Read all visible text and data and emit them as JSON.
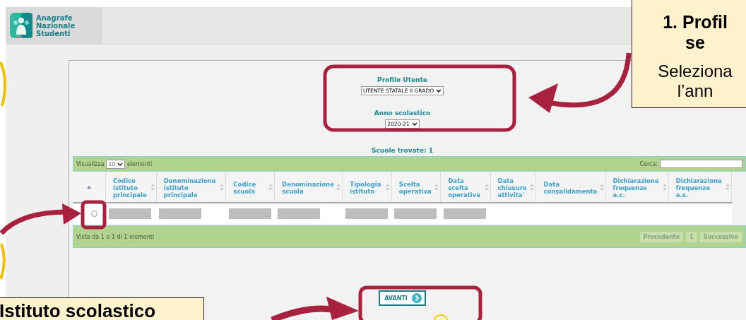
{
  "header": {
    "logo_text": "Anagrafe Nazionale Studenti"
  },
  "form": {
    "profile_label": "Profilo Utente",
    "profile_value": "UTENTE STATALE II GRADO",
    "year_label": "Anno scolastico",
    "year_value": "2020-21",
    "found": "Scuole trovate: 1"
  },
  "table_toolbar": {
    "show_prefix": "Visualizza",
    "page_size": "10",
    "show_suffix": "elementi",
    "search_label": "Cerca:"
  },
  "table": {
    "columns": [
      {
        "sorted": true
      },
      {
        "label": "Codice istituto principale",
        "sorted": false
      },
      {
        "label": "Denominazione istituto principale",
        "sorted": false
      },
      {
        "label": "Codice scuola",
        "sorted": false
      },
      {
        "label": "Denominazione scuola",
        "sorted": false
      },
      {
        "label": "Tipologia istituto",
        "sorted": false
      },
      {
        "label": "Scelta operativa",
        "sorted": false
      },
      {
        "label": "Data scelta operativa",
        "sorted": false
      },
      {
        "label": "Data chiusura attivita'",
        "sorted": false
      },
      {
        "label": "Data consolidamento",
        "sorted": false
      },
      {
        "label": "Dichiarazione frequenze a.c.",
        "sorted": false
      },
      {
        "label": "Dichiarazione frequenze a.s.",
        "sorted": false
      }
    ],
    "rows": [
      {
        "selected": false,
        "cells": [
          {
            "kind": "redacted"
          },
          {
            "kind": "redacted"
          },
          {
            "kind": "redacted"
          },
          {
            "kind": "redacted"
          },
          {
            "kind": "redacted"
          },
          {
            "kind": "redacted"
          },
          {
            "kind": "redacted"
          },
          {
            "kind": "empty"
          },
          {
            "kind": "empty"
          },
          {
            "kind": "empty"
          },
          {
            "kind": "empty"
          }
        ]
      }
    ]
  },
  "table_footer": {
    "info": "Vista da 1 a 1 di 1 elementi",
    "pages": [
      {
        "label": "Precedente",
        "disabled": true
      },
      {
        "label": "1",
        "disabled": true
      },
      {
        "label": "Successivo",
        "disabled": true
      }
    ]
  },
  "next_button": {
    "label": "AVANTI"
  },
  "callouts": [
    {
      "kind": "top-right",
      "title_lines": [
        "1. Profil",
        "se"
      ],
      "body_lines": [
        "Seleziona",
        "l’ann"
      ]
    },
    {
      "kind": "bottom-left",
      "title_lines": [
        "Istituto scolastico"
      ]
    }
  ]
}
